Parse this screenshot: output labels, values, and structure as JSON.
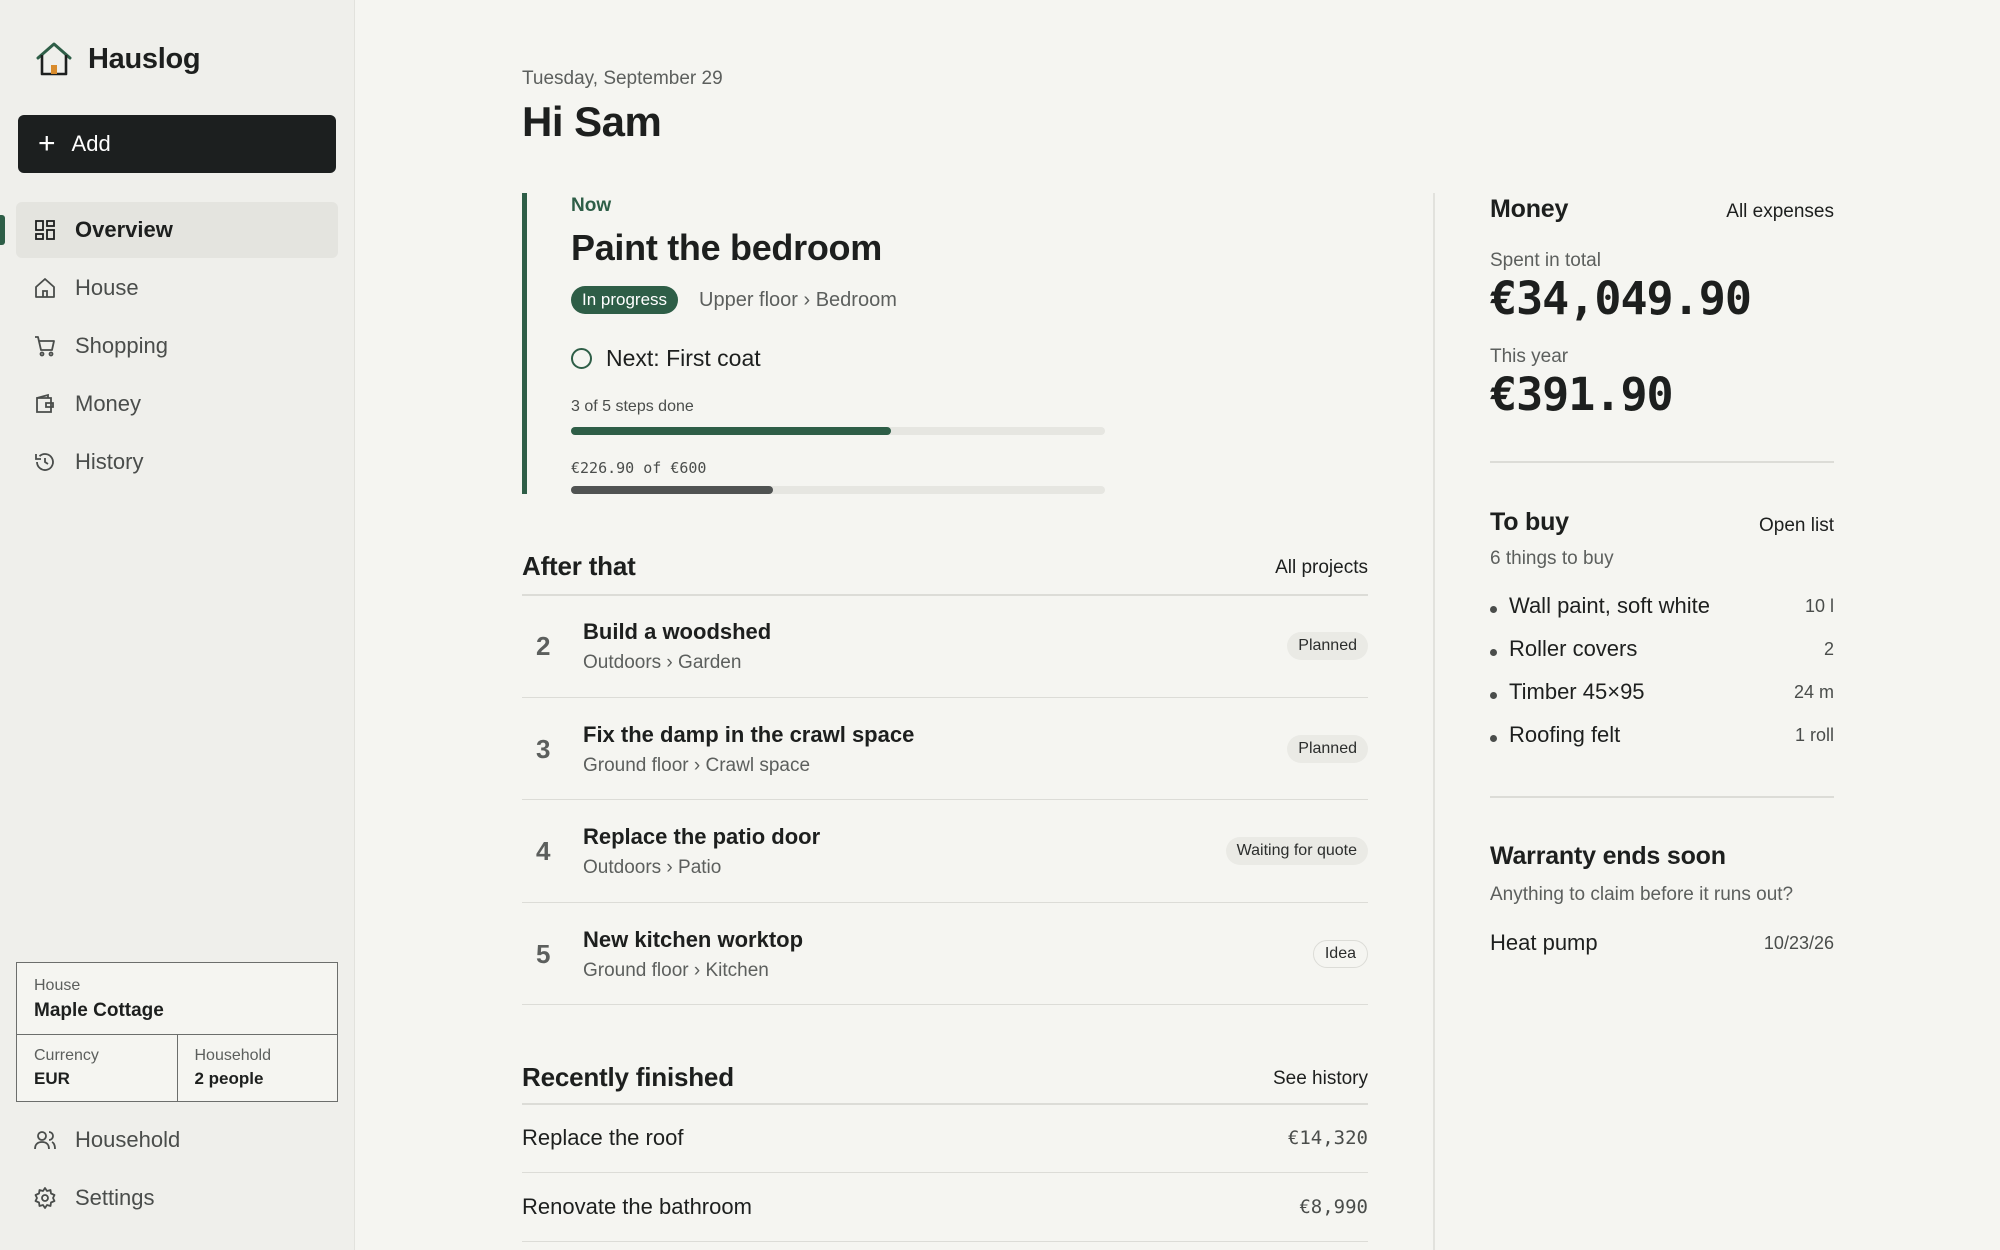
{
  "brand": {
    "name": "Hauslog",
    "icon": "house-logo-icon"
  },
  "sidebar": {
    "add_label": "Add",
    "nav": [
      {
        "label": "Overview",
        "icon": "grid-icon",
        "active": true
      },
      {
        "label": "House",
        "icon": "home-icon"
      },
      {
        "label": "Shopping",
        "icon": "cart-icon"
      },
      {
        "label": "Money",
        "icon": "wallet-icon"
      },
      {
        "label": "History",
        "icon": "history-icon"
      }
    ],
    "house_card": {
      "house_label": "House",
      "house_value": "Maple Cottage",
      "currency_label": "Currency",
      "currency_value": "EUR",
      "household_label": "Household",
      "household_value": "2 people"
    },
    "bottom_nav": [
      {
        "label": "Household",
        "icon": "people-icon"
      },
      {
        "label": "Settings",
        "icon": "gear-icon"
      }
    ]
  },
  "header": {
    "date": "Tuesday, September 29",
    "greeting": "Hi Sam"
  },
  "now": {
    "label": "Now",
    "title": "Paint the bedroom",
    "status": "In progress",
    "location": "Upper floor › Bedroom",
    "next_step": "Next: First coat",
    "steps_label": "3 of 5 steps done",
    "steps_fraction": 0.6,
    "budget_label": "€226.90 of €600",
    "budget_fraction": 0.378,
    "accent": "#2e5e47",
    "budget_bar_color": "#505352"
  },
  "after_that": {
    "title": "After that",
    "link": "All projects",
    "projects": [
      {
        "num": "2",
        "name": "Build a woodshed",
        "location": "Outdoors › Garden",
        "status": "Planned"
      },
      {
        "num": "3",
        "name": "Fix the damp in the crawl space",
        "location": "Ground floor › Crawl space",
        "status": "Planned"
      },
      {
        "num": "4",
        "name": "Replace the patio door",
        "location": "Outdoors › Patio",
        "status": "Waiting for quote"
      },
      {
        "num": "5",
        "name": "New kitchen worktop",
        "location": "Ground floor › Kitchen",
        "status": "Idea"
      }
    ]
  },
  "recently_finished": {
    "title": "Recently finished",
    "link": "See history",
    "items": [
      {
        "name": "Replace the roof",
        "amount": "€14,320"
      },
      {
        "name": "Renovate the bathroom",
        "amount": "€8,990"
      }
    ]
  },
  "money": {
    "title": "Money",
    "link": "All expenses",
    "total_label": "Spent in total",
    "total_value": "€34,049.90",
    "year_label": "This year",
    "year_value": "€391.90"
  },
  "to_buy": {
    "title": "To buy",
    "link": "Open list",
    "count_label": "6 things to buy",
    "items": [
      {
        "name": "Wall paint, soft white",
        "qty": "10 l"
      },
      {
        "name": "Roller covers",
        "qty": "2"
      },
      {
        "name": "Timber 45×95",
        "qty": "24 m"
      },
      {
        "name": "Roofing felt",
        "qty": "1 roll"
      }
    ]
  },
  "warranty": {
    "title": "Warranty ends soon",
    "subtitle": "Anything to claim before it runs out?",
    "items": [
      {
        "name": "Heat pump",
        "date": "10/23/26"
      }
    ]
  }
}
